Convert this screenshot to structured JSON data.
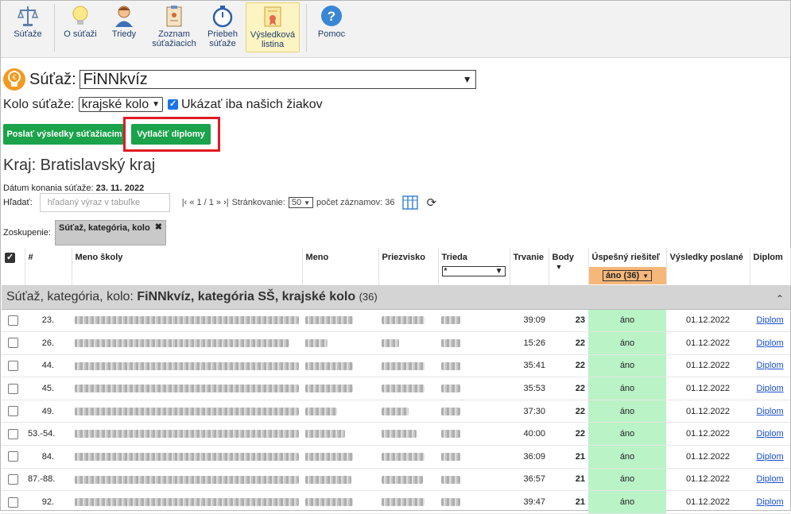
{
  "toolbar": {
    "items": [
      {
        "label": "Súťaže",
        "icon": "scales-icon"
      },
      {
        "label": "O súťaži",
        "icon": "lightbulb-icon"
      },
      {
        "label": "Triedy",
        "icon": "person-icon"
      },
      {
        "label": "Zoznam súťažiacich",
        "icon": "clipboard-icon"
      },
      {
        "label": "Priebeh súťaže",
        "icon": "stopwatch-icon"
      },
      {
        "label": "Výsledková listina",
        "icon": "certificate-icon"
      },
      {
        "label": "Pomoc",
        "icon": "help-icon"
      }
    ]
  },
  "competition": {
    "label": "Súťaž:",
    "value": "FiNNkvíz"
  },
  "round": {
    "label": "Kolo súťaže:",
    "value": "krajské kolo",
    "only_ours_label": "Ukázať iba našich žiakov",
    "only_ours": true
  },
  "buttons": {
    "send_results": "Poslať výsledky súťažiacim",
    "print_diplomas": "Vytlačiť diplomy"
  },
  "region_title": "Kraj: Bratislavský kraj",
  "date": {
    "label": "Dátum konania súťaže:",
    "value": "23. 11. 2022"
  },
  "search": {
    "label": "Hľadať:",
    "placeholder": "hľadaný výraz v tabuľke"
  },
  "pager": {
    "nav": "|‹ « 1 / 1 » ›|",
    "paging_label": "Stránkovanie:",
    "page_size": "50",
    "count_label": "počet záznamov: 36"
  },
  "grouping": {
    "label": "Zoskupenie:",
    "chip": "Súťaž, kategória, kolo"
  },
  "table": {
    "headers": [
      "#",
      "Meno školy",
      "Meno",
      "Priezvisko",
      "Trieda",
      "Trvanie",
      "Body",
      "Úspešný riešiteľ",
      "Výsledky poslané",
      "Diplom"
    ],
    "trieda_filter": "*",
    "success_filter": "áno (36)",
    "group_prefix": "Súťaž, kategória, kolo:",
    "group_name": "FiNNkvíz, kategória SŠ, krajské kolo",
    "group_count": "(36)",
    "rows": [
      {
        "rank": "23.",
        "duration": "39:09",
        "points": "23",
        "success": "áno",
        "sent": "01.12.2022",
        "diploma": "Diplom"
      },
      {
        "rank": "26.",
        "duration": "15:26",
        "points": "22",
        "success": "áno",
        "sent": "01.12.2022",
        "diploma": "Diplom"
      },
      {
        "rank": "44.",
        "duration": "35:41",
        "points": "22",
        "success": "áno",
        "sent": "01.12.2022",
        "diploma": "Diplom"
      },
      {
        "rank": "45.",
        "duration": "35:53",
        "points": "22",
        "success": "áno",
        "sent": "01.12.2022",
        "diploma": "Diplom"
      },
      {
        "rank": "49.",
        "duration": "37:30",
        "points": "22",
        "success": "áno",
        "sent": "01.12.2022",
        "diploma": "Diplom"
      },
      {
        "rank": "53.-54.",
        "duration": "40:00",
        "points": "22",
        "success": "áno",
        "sent": "01.12.2022",
        "diploma": "Diplom"
      },
      {
        "rank": "84.",
        "duration": "36:09",
        "points": "21",
        "success": "áno",
        "sent": "01.12.2022",
        "diploma": "Diplom"
      },
      {
        "rank": "87.-88.",
        "duration": "36:57",
        "points": "21",
        "success": "áno",
        "sent": "01.12.2022",
        "diploma": "Diplom"
      },
      {
        "rank": "92.",
        "duration": "39:47",
        "points": "21",
        "success": "áno",
        "sent": "01.12.2022",
        "diploma": "Diplom"
      }
    ]
  },
  "colors": {
    "green_button": "#1aa34a",
    "highlight_red": "#e01b22",
    "success_cell": "#b9f3c6",
    "filter_orange": "#f6b77a"
  }
}
